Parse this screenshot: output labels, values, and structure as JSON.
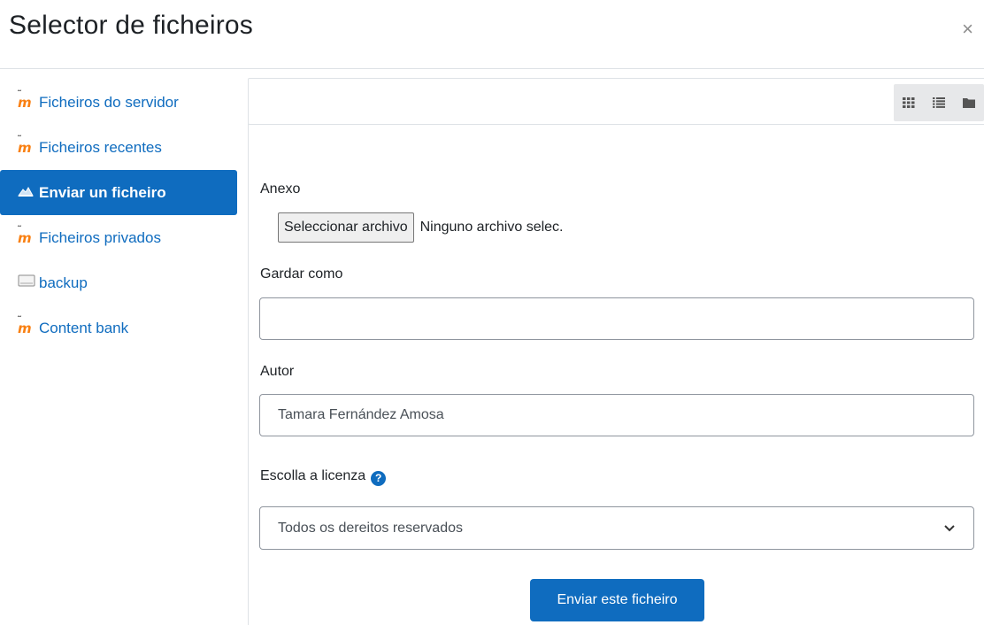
{
  "modal": {
    "title": "Selector de ficheiros",
    "close_label": "×"
  },
  "sidebar": {
    "items": [
      {
        "label": "Ficheiros do servidor",
        "icon": "moodle-icon",
        "active": false
      },
      {
        "label": "Ficheiros recentes",
        "icon": "moodle-icon",
        "active": false
      },
      {
        "label": "Enviar un ficheiro",
        "icon": "upload-icon",
        "active": true
      },
      {
        "label": "Ficheiros privados",
        "icon": "moodle-icon",
        "active": false
      },
      {
        "label": "backup",
        "icon": "folder-drive-icon",
        "active": false
      },
      {
        "label": "Content bank",
        "icon": "moodle-icon",
        "active": false
      }
    ]
  },
  "toolbar": {
    "views": [
      "grid-view-icon",
      "list-view-icon",
      "tree-view-icon"
    ]
  },
  "form": {
    "attachment_label": "Anexo",
    "choose_file_label": "Seleccionar archivo",
    "no_file_text": "Ninguno archivo selec.",
    "save_as_label": "Gardar como",
    "save_as_value": "",
    "author_label": "Autor",
    "author_value": "Tamara Fernández Amosa",
    "license_label": "Escolla a licenza",
    "license_value": "Todos os dereitos reservados",
    "submit_label": "Enviar este ficheiro"
  },
  "colors": {
    "accent": "#0f6cbf",
    "moodle_orange": "#f98012"
  }
}
